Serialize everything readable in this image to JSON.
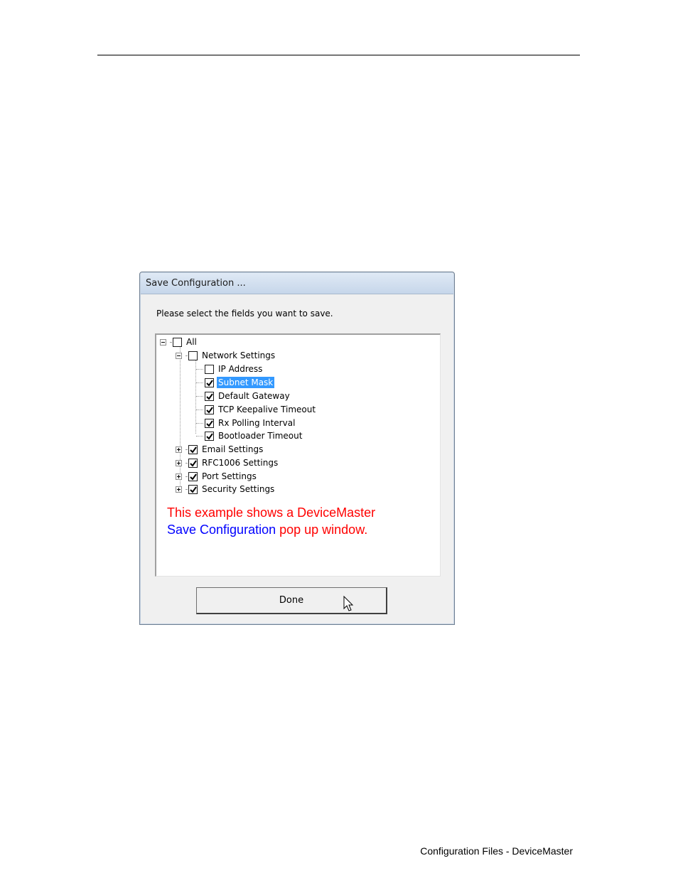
{
  "document": {
    "footer": "Configuration Files - DeviceMaster"
  },
  "dialog": {
    "title": "Save Configuration ...",
    "prompt": "Please select the fields you want to save.",
    "tree": [
      {
        "label": "All",
        "checked": false,
        "expander": "minus"
      },
      {
        "label": "Network Settings",
        "checked": false,
        "expander": "minus"
      },
      {
        "label": "IP Address",
        "checked": false
      },
      {
        "label": "Subnet Mask",
        "checked": true,
        "selected": true
      },
      {
        "label": "Default Gateway",
        "checked": true
      },
      {
        "label": "TCP Keepalive Timeout",
        "checked": true
      },
      {
        "label": "Rx Polling Interval",
        "checked": true
      },
      {
        "label": "Bootloader Timeout",
        "checked": true
      },
      {
        "label": "Email Settings",
        "checked": true,
        "expander": "plus"
      },
      {
        "label": "RFC1006 Settings",
        "checked": true,
        "expander": "plus"
      },
      {
        "label": "Port Settings",
        "checked": true,
        "expander": "plus"
      },
      {
        "label": "Security Settings",
        "checked": true,
        "expander": "plus"
      }
    ],
    "note": {
      "line1": "This example shows a DeviceMaster",
      "line2_blue": "Save Configuration",
      "line2_red": " pop up window."
    },
    "done_label": "Done"
  },
  "colors": {
    "note_red": "#ff0000",
    "note_blue": "#0000ff",
    "selection": "#3399ff"
  },
  "icons": {
    "check": "checkmark-icon",
    "cursor": "mouse-pointer-icon"
  }
}
